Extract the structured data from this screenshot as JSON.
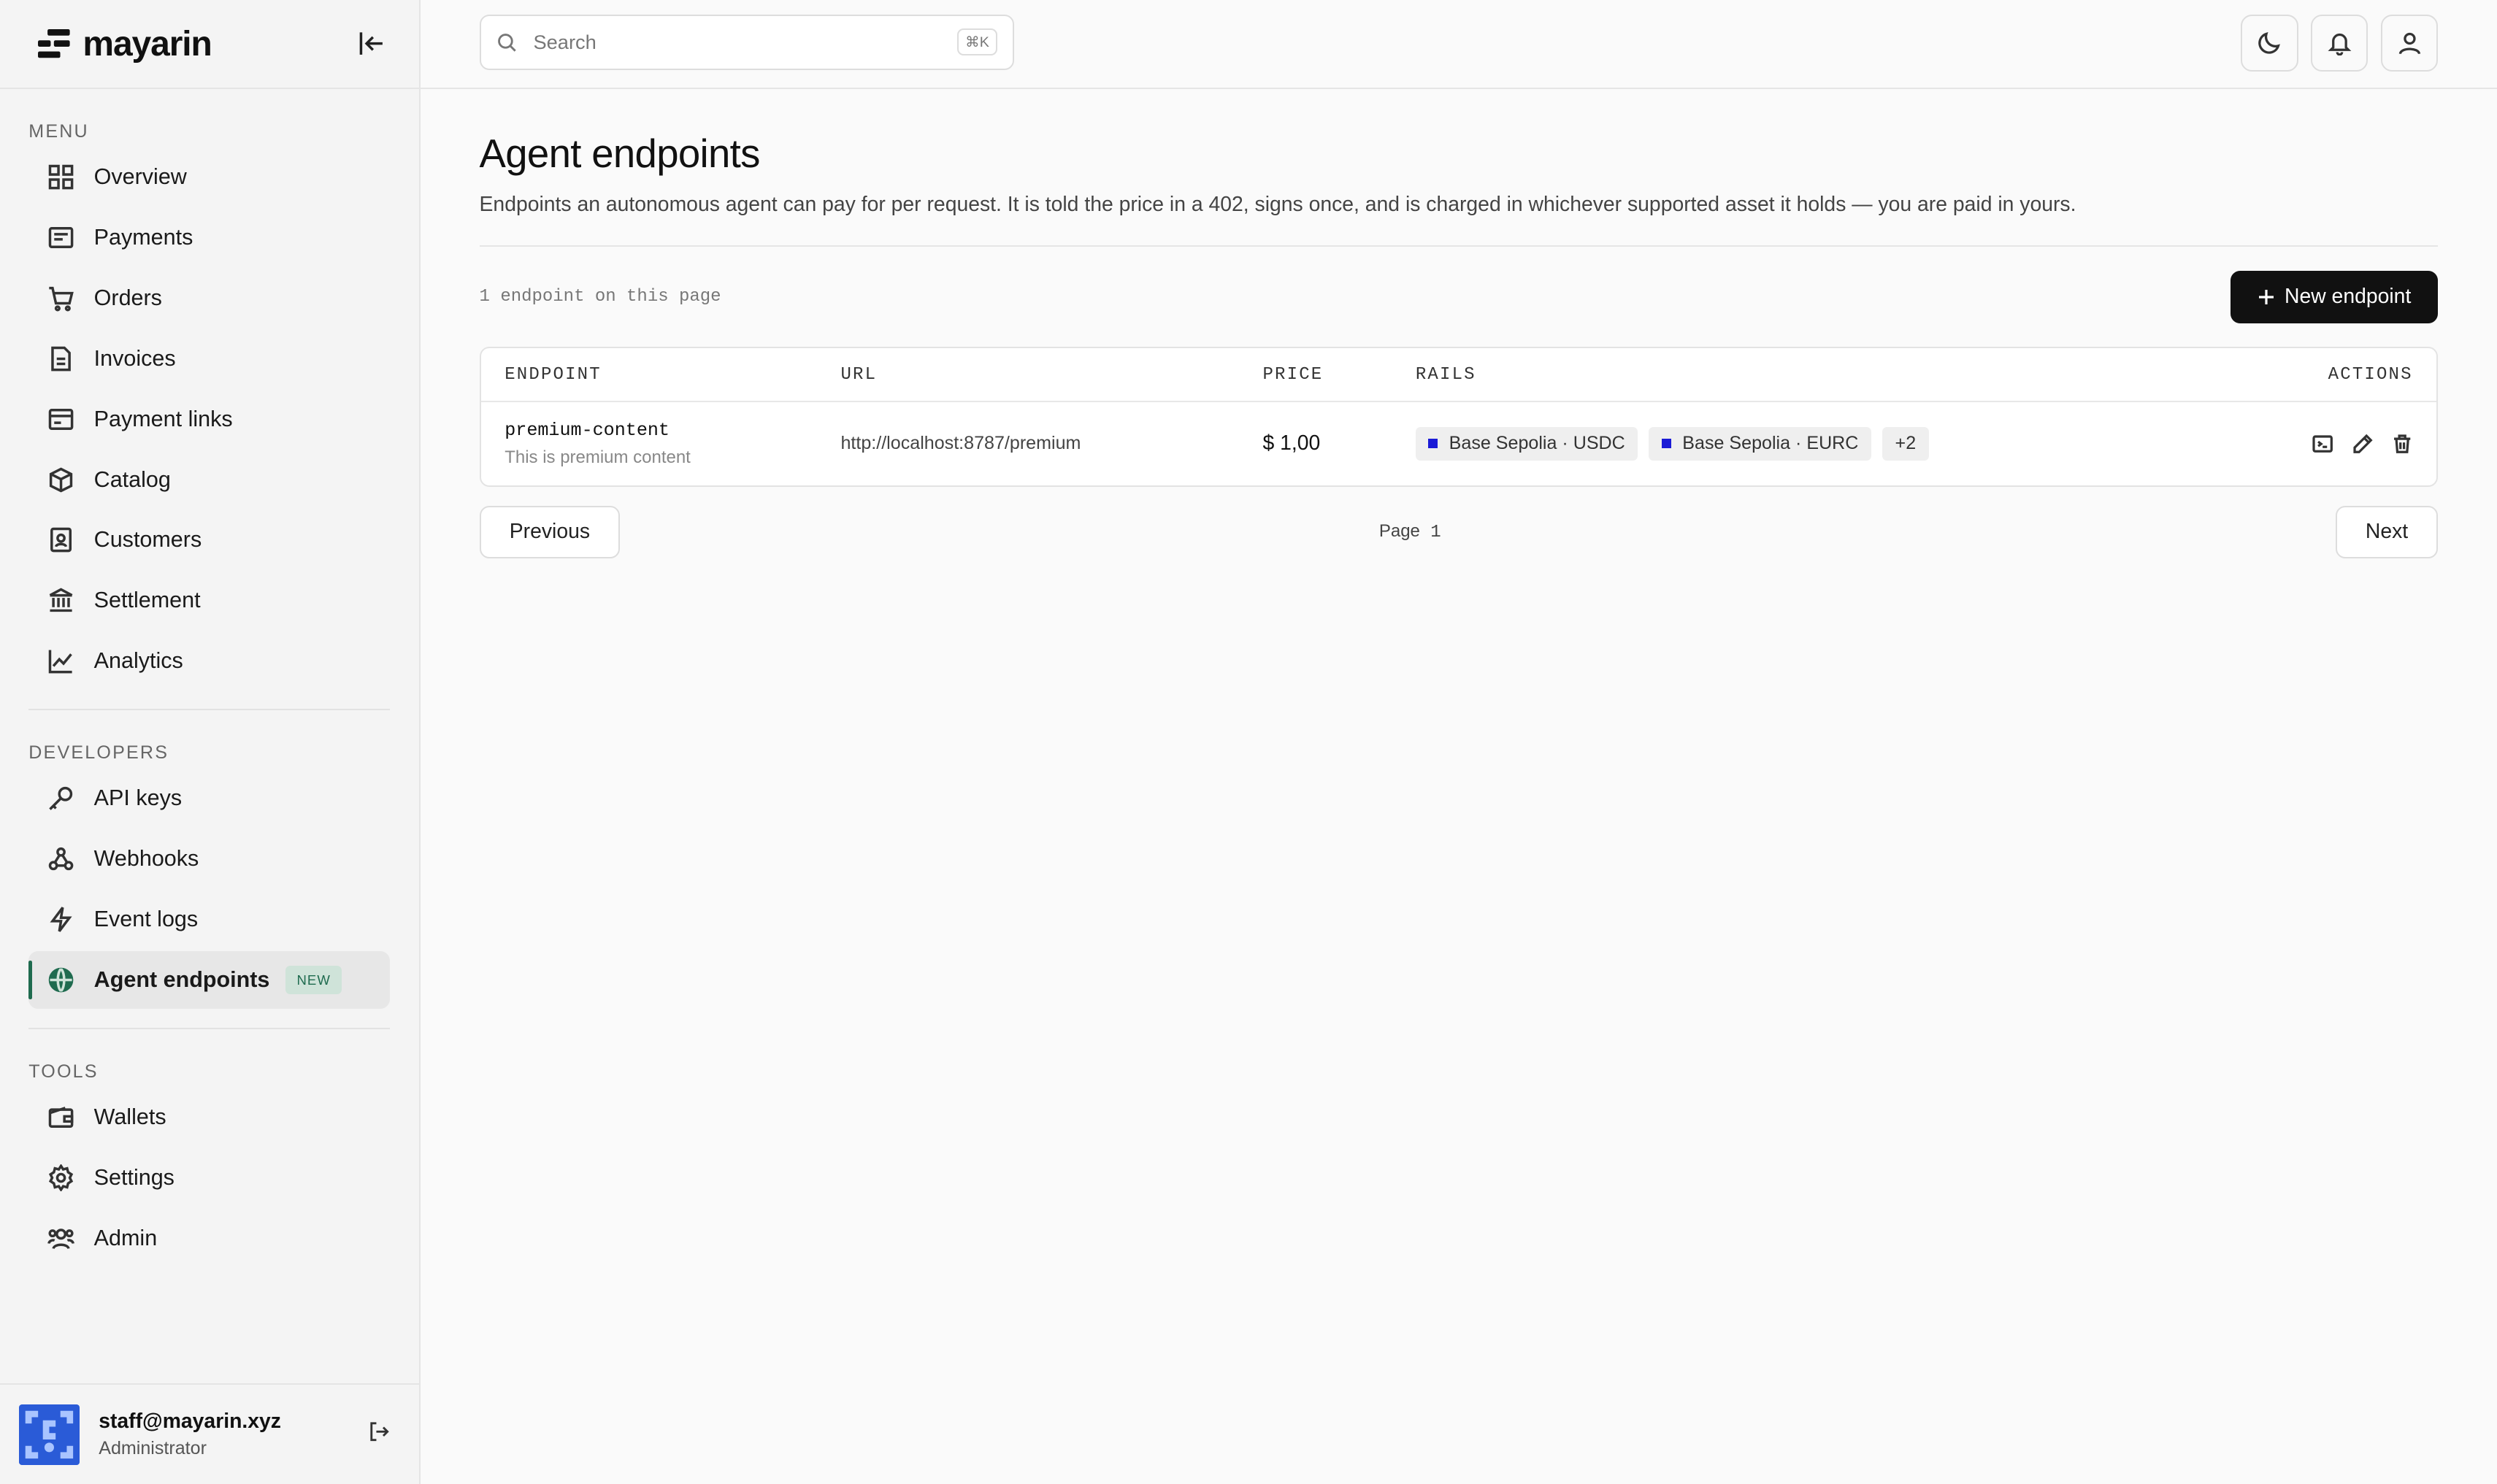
{
  "app": {
    "name": "mayarin"
  },
  "search": {
    "placeholder": "Search",
    "shortcut": "⌘K"
  },
  "sidebar": {
    "sections": [
      {
        "label": "MENU",
        "items": [
          {
            "label": "Overview",
            "icon": "grid-icon"
          },
          {
            "label": "Payments",
            "icon": "receipt-icon"
          },
          {
            "label": "Orders",
            "icon": "cart-icon"
          },
          {
            "label": "Invoices",
            "icon": "document-icon"
          },
          {
            "label": "Payment links",
            "icon": "link-card-icon"
          },
          {
            "label": "Catalog",
            "icon": "box-icon"
          },
          {
            "label": "Customers",
            "icon": "contact-icon"
          },
          {
            "label": "Settlement",
            "icon": "bank-icon"
          },
          {
            "label": "Analytics",
            "icon": "chart-icon"
          }
        ]
      },
      {
        "label": "DEVELOPERS",
        "items": [
          {
            "label": "API keys",
            "icon": "key-icon"
          },
          {
            "label": "Webhooks",
            "icon": "webhook-icon"
          },
          {
            "label": "Event logs",
            "icon": "bolt-icon"
          },
          {
            "label": "Agent endpoints",
            "icon": "globe-icon",
            "badge": "NEW",
            "active": true
          }
        ]
      },
      {
        "label": "TOOLS",
        "items": [
          {
            "label": "Wallets",
            "icon": "wallet-icon"
          },
          {
            "label": "Settings",
            "icon": "gear-icon"
          },
          {
            "label": "Admin",
            "icon": "users-icon"
          }
        ]
      }
    ]
  },
  "user": {
    "email": "staff@mayarin.xyz",
    "role": "Administrator"
  },
  "page": {
    "title": "Agent endpoints",
    "description": "Endpoints an autonomous agent can pay for per request. It is told the price in a 402, signs once, and is charged in whichever supported asset it holds — you are paid in yours.",
    "count_text": "1 endpoint on this page",
    "new_button": "New endpoint"
  },
  "table": {
    "headers": {
      "endpoint": "ENDPOINT",
      "url": "URL",
      "price": "PRICE",
      "rails": "RAILS",
      "actions": "ACTIONS"
    },
    "rows": [
      {
        "name": "premium-content",
        "description": "This is premium content",
        "url": "http://localhost:8787/premium",
        "price": "$ 1,00",
        "rails": [
          "Base Sepolia · USDC",
          "Base Sepolia · EURC"
        ],
        "more": "+2"
      }
    ]
  },
  "pagination": {
    "previous": "Previous",
    "page_label": "Page",
    "page_number": "1",
    "next": "Next"
  },
  "colors": {
    "accent": "#1f6b4f",
    "primary_button": "#111111",
    "rail_dot": "#1b1bd6",
    "avatar": "#2a5bd7"
  }
}
